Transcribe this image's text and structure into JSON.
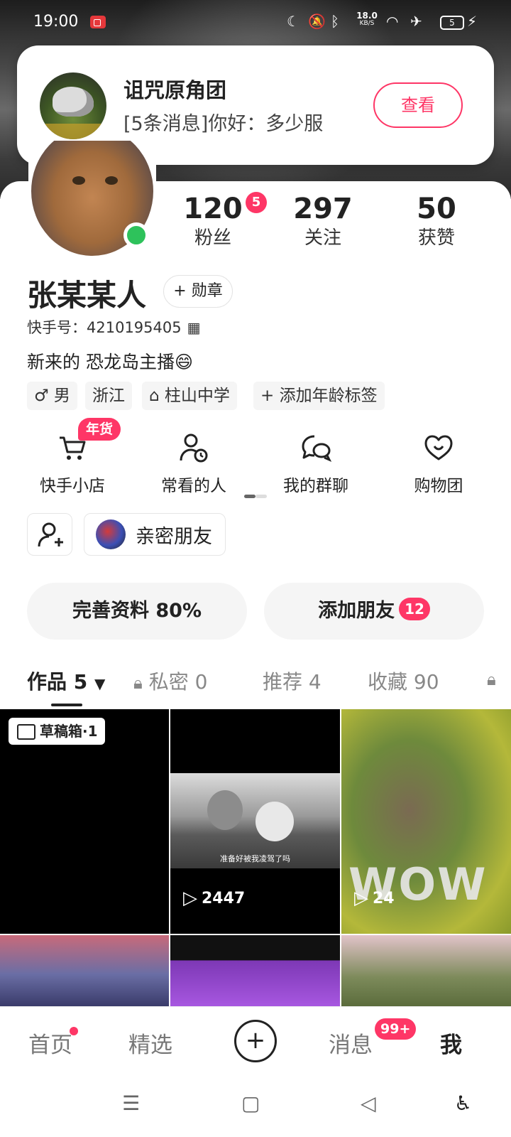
{
  "status_bar": {
    "time": "19:00",
    "net_speed_value": "18.0",
    "net_speed_unit": "KB/S",
    "battery_level": "5"
  },
  "notification": {
    "title": "诅咒原角团",
    "message": "[5条消息]你好：多少服",
    "view_label": "查看"
  },
  "profile": {
    "stats": {
      "fans": {
        "value": "120",
        "label": "粉丝",
        "badge": "5"
      },
      "following": {
        "value": "297",
        "label": "关注"
      },
      "likes": {
        "value": "50",
        "label": "获赞"
      }
    },
    "name": "张某某人",
    "badge_button": "+ 勋章",
    "id_label": "快手号：4210195405",
    "bio": "新来的 恐龙岛主播😄",
    "tags": {
      "gender": "♂ 男",
      "region": "浙江",
      "school": "⌂ 柱山中学",
      "add_age": "+ 添加年龄标签"
    }
  },
  "quick_actions": {
    "shop": {
      "label": "快手小店",
      "badge": "年货"
    },
    "frequent": {
      "label": "常看的人"
    },
    "groups": {
      "label": "我的群聊"
    },
    "shopping_group": {
      "label": "购物团"
    }
  },
  "friends_row": {
    "close_friends_label": "亲密朋友"
  },
  "actions": {
    "complete_profile": "完善资料 80%",
    "add_friends": "添加朋友",
    "add_friends_badge": "12"
  },
  "content_tabs": {
    "works": "作品 5",
    "private": "私密 0",
    "recommend": "推荐 4",
    "favorites": "收藏 90"
  },
  "grid": {
    "draft_label": "草稿箱·1",
    "caption_2": "准备好被我凌驾了吗",
    "plays_2": "2447",
    "plays_3": "24",
    "wow_text": "WOW"
  },
  "bottom_nav": {
    "home": "首页",
    "featured": "精选",
    "messages": "消息",
    "messages_badge": "99+",
    "me": "我"
  },
  "colors": {
    "accent": "#fe3666",
    "online": "#2ec25b"
  }
}
